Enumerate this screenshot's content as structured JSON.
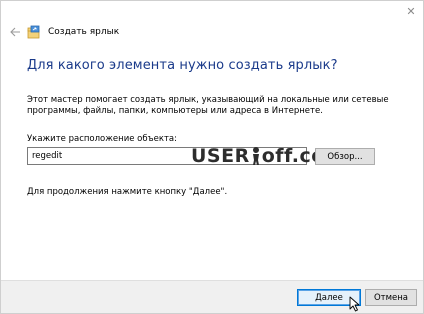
{
  "window": {
    "title": "Создать ярлык",
    "close_glyph": "✕"
  },
  "heading": "Для какого элемента нужно создать ярлык?",
  "description": "Этот мастер помогает создать ярлык, указывающий на локальные или сетевые программы, файлы, папки, компьютеры или адреса в Интернете.",
  "location": {
    "label": "Укажите расположение объекта:",
    "value": "regedit",
    "browse_label": "Обзор..."
  },
  "watermark": {
    "text_left": "USER",
    "text_right": "off.com"
  },
  "hint": "Для продолжения нажмите кнопку \"Далее\".",
  "footer": {
    "next_label": "Далее",
    "cancel_label": "Отмена"
  },
  "colors": {
    "heading": "#1a3a8a",
    "default_button_border": "#0078d7",
    "footer_bg": "#f0f0f0"
  },
  "icons": {
    "back": "back-arrow-icon",
    "wizard": "shortcut-wizard-icon",
    "close": "close-icon",
    "cursor": "mouse-pointer-icon"
  }
}
